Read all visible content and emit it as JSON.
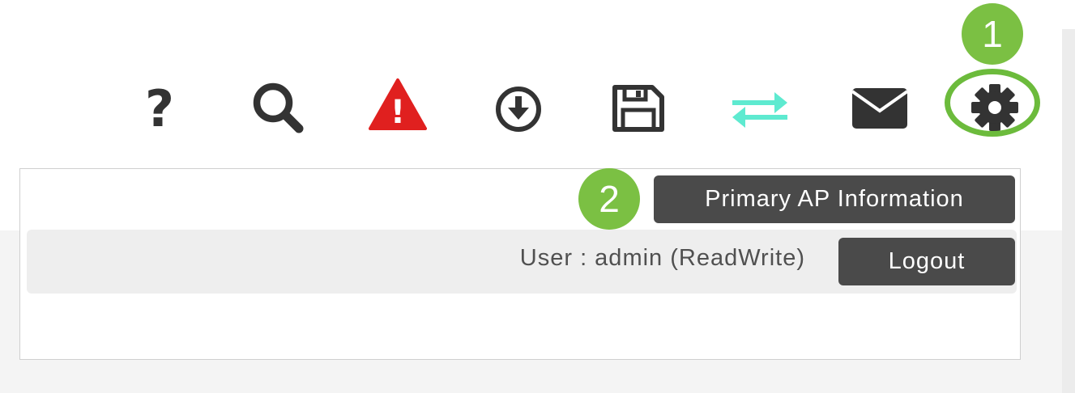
{
  "toolbar": {
    "icons": [
      {
        "name": "help-icon",
        "glyph": "?",
        "color": "#333333"
      },
      {
        "name": "search-icon",
        "color": "#333333"
      },
      {
        "name": "alert-icon",
        "glyph": "!",
        "color": "#e0201f"
      },
      {
        "name": "download-icon",
        "color": "#333333"
      },
      {
        "name": "save-icon",
        "color": "#333333"
      },
      {
        "name": "sync-icon",
        "color": "#5eead0"
      },
      {
        "name": "mail-icon",
        "color": "#333333"
      },
      {
        "name": "gear-icon",
        "color": "#333333"
      }
    ]
  },
  "callouts": {
    "step1": "1",
    "step2": "2",
    "color": "#7bc043"
  },
  "menu": {
    "primary_ap_label": "Primary AP Information",
    "user_text": "User : admin (ReadWrite)",
    "logout_label": "Logout"
  }
}
